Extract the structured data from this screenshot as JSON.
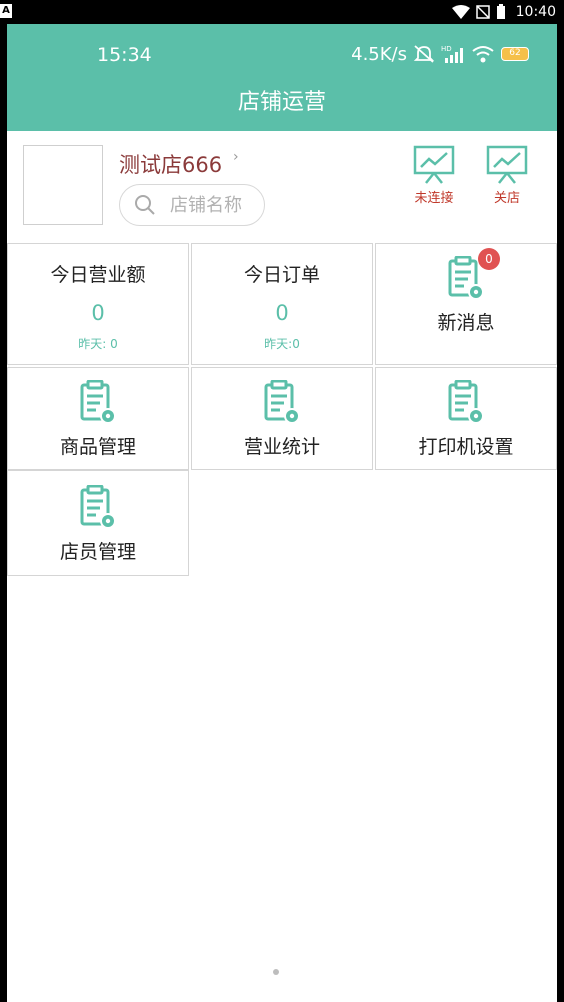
{
  "system_bar": {
    "left_icon": "A",
    "time": "10:40",
    "icons": [
      "wifi-icon",
      "signal-icon",
      "battery-icon"
    ]
  },
  "inner_status": {
    "time": "15:34",
    "net_speed": "4.5K/s",
    "battery": "62"
  },
  "header": {
    "title": "店铺运营",
    "color": "#5bbfa9"
  },
  "store": {
    "name": "测试店666",
    "search_placeholder": "店铺名称",
    "connection_label": "未连接",
    "close_label": "关店"
  },
  "stats": {
    "revenue": {
      "title": "今日营业额",
      "value": "0",
      "yesterday": "昨天: 0"
    },
    "orders": {
      "title": "今日订单",
      "value": "0",
      "yesterday": "昨天:0"
    }
  },
  "menu": {
    "messages": {
      "label": "新消息",
      "badge": "0"
    },
    "products": {
      "label": "商品管理"
    },
    "statistics": {
      "label": "营业统计"
    },
    "printer": {
      "label": "打印机设置"
    },
    "staff": {
      "label": "店员管理"
    }
  },
  "colors": {
    "accent": "#5bbfa9",
    "store_name": "#8b3a3a",
    "badge": "#e05252",
    "status_label": "#c0392b"
  }
}
